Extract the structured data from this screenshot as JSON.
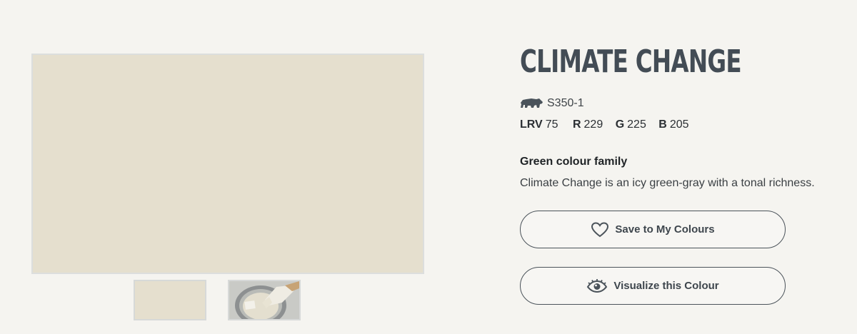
{
  "colors": {
    "swatch": "#e5dfce",
    "title": "#434c55",
    "button_border": "#4b535a"
  },
  "color": {
    "name": "CLIMATE CHANGE",
    "code": "S350-1",
    "lrv_label": "LRV",
    "lrv_value": "75",
    "r_label": "R",
    "r_value": "229",
    "g_label": "G",
    "g_value": "225",
    "b_label": "B",
    "b_value": "205",
    "family": "Green colour family",
    "description": "Climate Change is an icy green-gray with a tonal richness."
  },
  "thumbnails": [
    {
      "type": "swatch"
    },
    {
      "type": "paint-can-photo"
    }
  ],
  "buttons": {
    "save_label": "Save to My Colours",
    "save_icon": "heart-icon",
    "visualize_label": "Visualize this Colour",
    "visualize_icon": "eye-icon"
  },
  "brand_icon": "bear-icon"
}
